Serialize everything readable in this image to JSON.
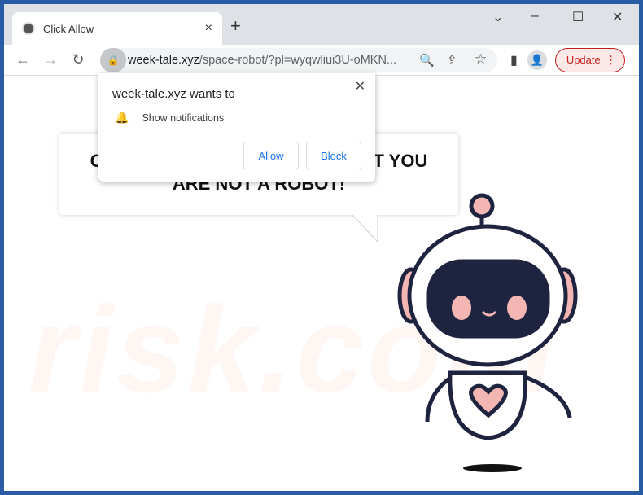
{
  "tab": {
    "title": "Click Allow",
    "close": "×",
    "new_tab": "+"
  },
  "window": {
    "dropdown": "⌄",
    "minimize": "–",
    "maximize": "☐",
    "close": "✕"
  },
  "toolbar": {
    "back": "←",
    "forward": "→",
    "reload": "↻",
    "url_domain": "week-tale.xyz",
    "url_rest": "/space-robot/?pl=wyqwliui3U-oMKN...",
    "zoom_icon": "🔍",
    "share_icon": "⇪",
    "bookmark_icon": "☆",
    "sidepanel_icon": "▮",
    "update_label": "Update",
    "menu": "⋮"
  },
  "popup": {
    "heading": "week-tale.xyz wants to",
    "permission": "Show notifications",
    "allow": "Allow",
    "block": "Block",
    "close": "✕"
  },
  "page": {
    "message": "CLICK ALLOW TO CONFIRM THAT YOU ARE NOT A ROBOT!",
    "watermark": "risk.com"
  },
  "colors": {
    "accent": "#1a73e8",
    "update": "#c5221f",
    "robot_outline": "#1e2340",
    "robot_pink": "#f4b6b2"
  }
}
